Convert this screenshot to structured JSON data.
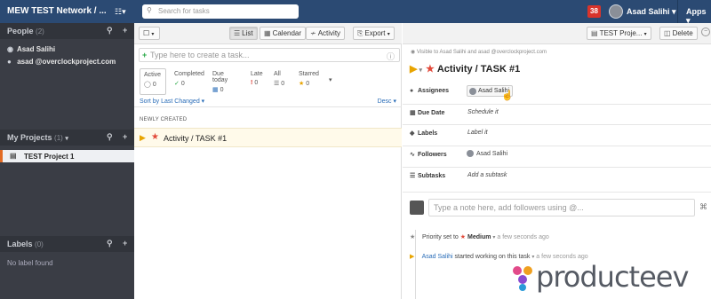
{
  "topbar": {
    "network_title": "MEW TEST Network / ...",
    "search_placeholder": "Search for tasks",
    "notification_count": "38",
    "user_name": "Asad Salihi",
    "apps_label": "Apps"
  },
  "sidebar": {
    "people_header": "People",
    "people_count": "(2)",
    "people": [
      {
        "name": "Asad Salihi"
      },
      {
        "name": "asad @overclockproject.com"
      }
    ],
    "projects_header": "My Projects",
    "projects_count": "(1)",
    "projects": [
      {
        "name": "TEST Project 1"
      }
    ],
    "labels_header": "Labels",
    "labels_count": "(0)",
    "no_label_text": "No label found"
  },
  "middle": {
    "view_buttons": {
      "list": "List",
      "calendar": "Calendar",
      "activity": "Activity"
    },
    "export_label": "Export",
    "new_task_placeholder": "Type here to create a task...",
    "filters": [
      {
        "label": "Active",
        "count": "0",
        "icon": "clock-icon"
      },
      {
        "label": "Completed",
        "count": "0",
        "icon": "check-icon"
      },
      {
        "label": "Due today",
        "count": "0",
        "icon": "calendar-icon"
      },
      {
        "label": "Late",
        "count": "0",
        "icon": "exclamation-icon"
      },
      {
        "label": "All",
        "count": "0",
        "icon": "list-icon"
      },
      {
        "label": "Starred",
        "count": "0",
        "icon": "star-icon"
      }
    ],
    "sort_label": "Sort by Last Changed",
    "desc_label": "Desc",
    "section_title": "NEWLY CREATED",
    "task_title": "Activity / TASK #1"
  },
  "right": {
    "project_dropdown": "TEST Proje...",
    "delete_label": "Delete",
    "visibility_text": "Visible to Asad Salihi and asad @overclockproject.com",
    "task_title": "Activity / TASK #1",
    "fields": {
      "assignees_label": "Assignees",
      "assignee_name": "Asad Salihi",
      "due_date_label": "Due Date",
      "due_date_value": "Schedule it",
      "labels_label": "Labels",
      "labels_value": "Label it",
      "followers_label": "Followers",
      "follower_name": "Asad Salihi",
      "subtasks_label": "Subtasks",
      "subtasks_value": "Add a subtask"
    },
    "note_placeholder": "Type a note here, add followers using @...",
    "activity": [
      {
        "prefix": "Priority set to",
        "value": "Medium",
        "time": "a few seconds ago"
      },
      {
        "actor": "Asad Salihi",
        "text": "started working on this task",
        "time": "a few seconds ago"
      }
    ]
  },
  "watermark": {
    "text": "producteev"
  },
  "colors": {
    "topbar": "#2b4a73",
    "sidebar": "#3a3d45",
    "accent_orange": "#e26b24",
    "star_red": "#e24a3b",
    "play_yellow": "#e8a400",
    "link_blue": "#2a6db8"
  }
}
